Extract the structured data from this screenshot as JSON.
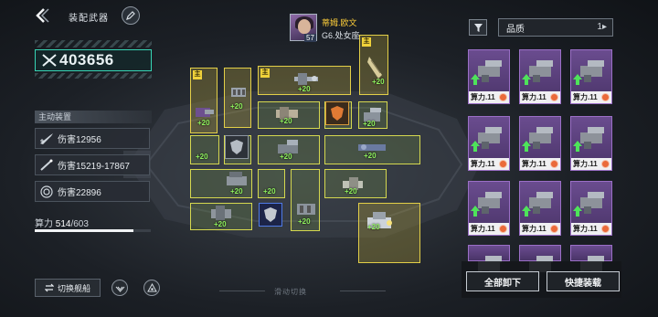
{
  "header": {
    "title": "装配武器"
  },
  "player": {
    "name": "蒂姆.欧文",
    "level": "57",
    "rank": "G6.处女座"
  },
  "power": {
    "value": "403656"
  },
  "active_equipment": {
    "label": "主动装置",
    "items": [
      {
        "text": "伤害12956",
        "icon": "missile-icon"
      },
      {
        "text": "伤害15219-17867",
        "icon": "laser-icon"
      },
      {
        "text": "伤害22896",
        "icon": "target-icon"
      }
    ]
  },
  "capacity": {
    "label": "算力",
    "used": "514",
    "total": "/603",
    "fill_fraction": 0.85
  },
  "bottom": {
    "switch_label": "切换舰船",
    "slide_hint": "滑动切换"
  },
  "grid": {
    "main_badge": "主",
    "bonus": "+20"
  },
  "right_panel": {
    "quality_label": "品质",
    "quality_sort": "1",
    "card_label": "算力.11",
    "unload_all": "全部卸下",
    "quick_equip": "快捷装载"
  },
  "colors": {
    "accent_teal": "#37d5b5",
    "slot_yellow": "#d5d84f",
    "bonus_green": "#8ef15d",
    "card_purple": "#6a4c8f",
    "player_name": "#ffcf3a"
  }
}
